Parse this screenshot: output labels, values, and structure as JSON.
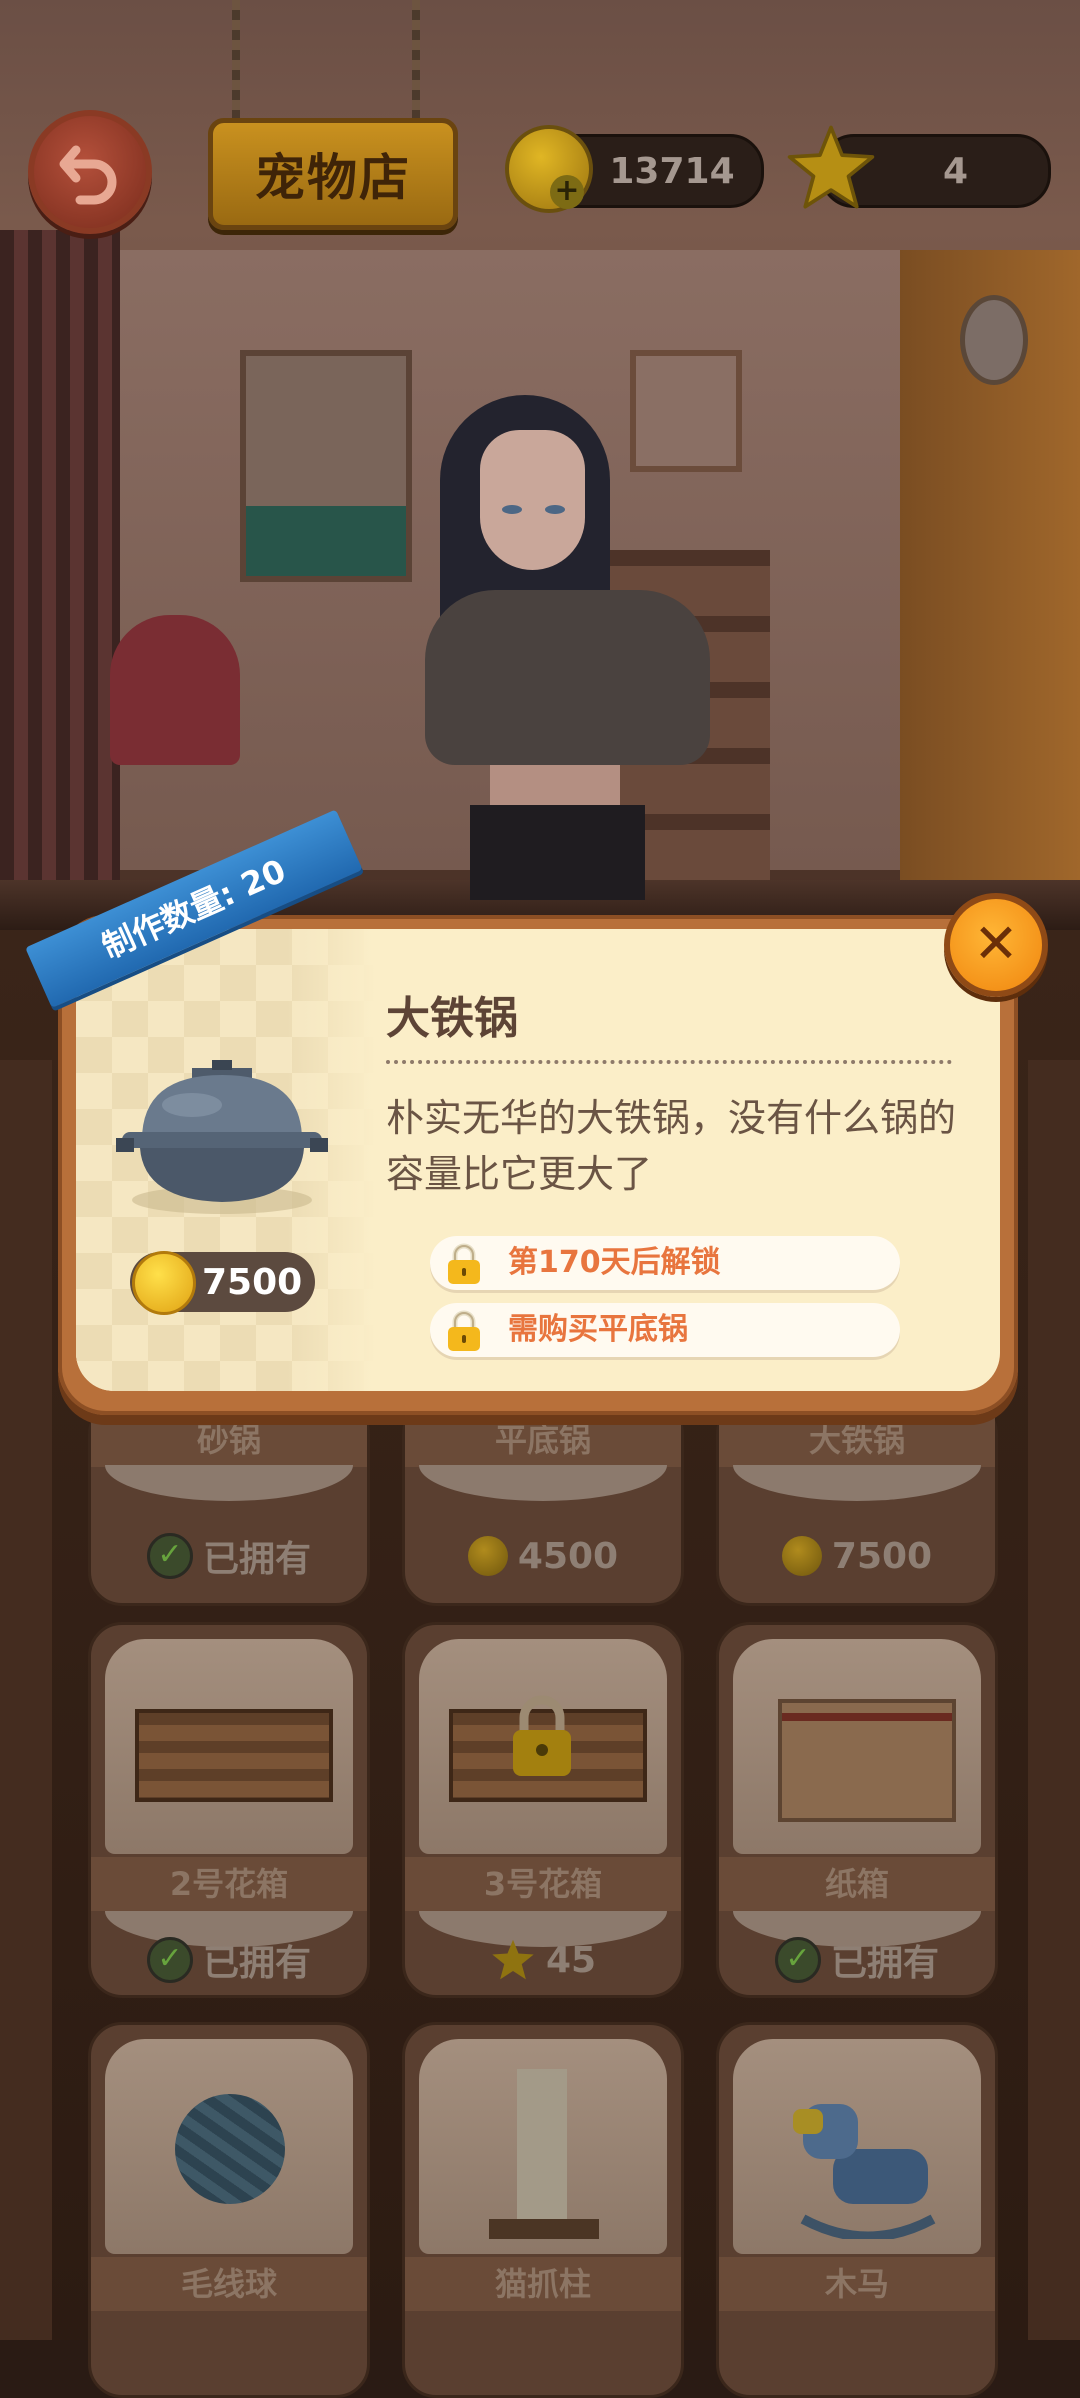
{
  "hud": {
    "shop_title": "宠物店",
    "coins": "13714",
    "stars": "4"
  },
  "modal": {
    "craft_count": "制作数量: 20",
    "item_name": "大铁锅",
    "description": "朴实无华的大铁锅，没有什么锅的容量比它更大了",
    "price": "7500",
    "requirements": [
      "第170天后解锁",
      "需购买平底锅"
    ],
    "close_icon": "close-icon"
  },
  "shop": {
    "row1": [
      {
        "name": "砂锅",
        "status": "已拥有",
        "status_type": "owned"
      },
      {
        "name": "平底锅",
        "status": "4500",
        "status_type": "coin"
      },
      {
        "name": "大铁锅",
        "status": "7500",
        "status_type": "coin"
      }
    ],
    "row2": [
      {
        "name": "2号花箱",
        "status": "已拥有",
        "status_type": "owned"
      },
      {
        "name": "3号花箱",
        "status": "45",
        "status_type": "star"
      },
      {
        "name": "纸箱",
        "status": "已拥有",
        "status_type": "owned"
      }
    ],
    "row3": [
      {
        "name": "毛线球"
      },
      {
        "name": "猫抓柱"
      },
      {
        "name": "木马"
      }
    ]
  },
  "colors": {
    "ribbon": "#2a7bc6",
    "close_button": "#f59a1c",
    "requirement_text": "#e8753e",
    "modal_bg": "#fbeec8"
  }
}
